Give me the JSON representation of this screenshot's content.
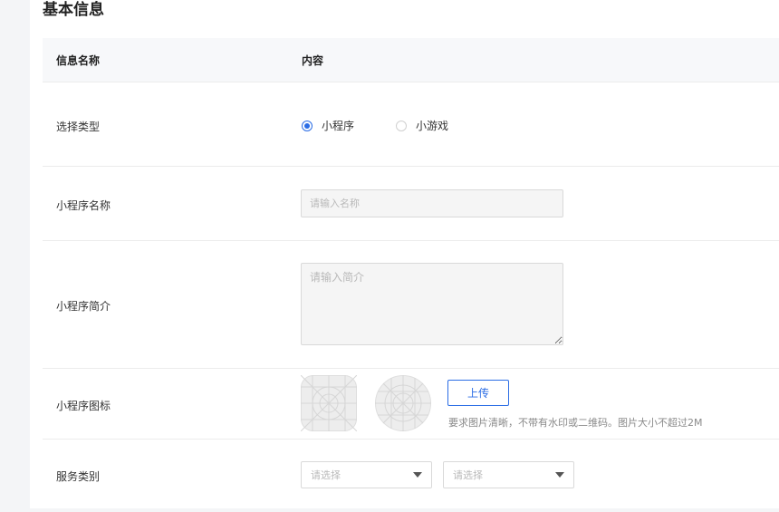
{
  "section": {
    "title": "基本信息"
  },
  "table": {
    "header": {
      "name": "信息名称",
      "content": "内容"
    },
    "type_row": {
      "label": "选择类型",
      "options": [
        {
          "label": "小程序",
          "checked": true
        },
        {
          "label": "小游戏",
          "checked": false
        }
      ]
    },
    "name_row": {
      "label": "小程序名称",
      "placeholder": "请输入名称",
      "value": ""
    },
    "intro_row": {
      "label": "小程序简介",
      "placeholder": "请输入简介",
      "value": ""
    },
    "icon_row": {
      "label": "小程序图标",
      "upload_label": "上传",
      "hint": "要求图片清晰，不带有水印或二维码。图片大小不超过2M"
    },
    "category_row": {
      "label": "服务类别",
      "selects": [
        {
          "value": "请选择"
        },
        {
          "value": "请选择"
        }
      ]
    }
  },
  "colors": {
    "accent": "#2b6de5",
    "header_bg": "#f7f8fa",
    "page_bg": "#f4f5f7"
  }
}
